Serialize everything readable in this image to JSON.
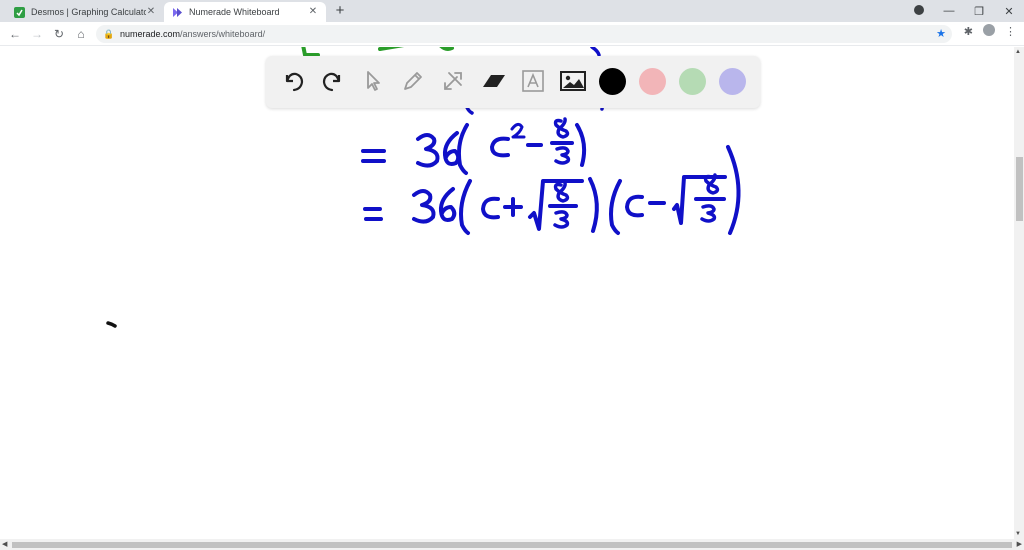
{
  "tabs": [
    {
      "title": "Desmos | Graphing Calculator",
      "icon": "desmos-icon",
      "active": false
    },
    {
      "title": "Numerade Whiteboard",
      "icon": "numerade-icon",
      "active": true
    }
  ],
  "address_bar": {
    "host": "numerade.com",
    "path": "/answers/whiteboard/"
  },
  "palette": {
    "tools": [
      "undo-icon",
      "redo-icon",
      "select-pointer-icon",
      "pen-icon",
      "tools-icon",
      "eraser-icon",
      "text-icon",
      "image-icon"
    ],
    "colors": [
      "#000000",
      "#f2b5b8",
      "#b5dbb4",
      "#b9b6ec"
    ],
    "selected_color": "#000000"
  },
  "handwriting": {
    "ink_color": "#1010c8",
    "green_ink_color": "#2a9d2a",
    "line1": "= 36 ( c² − 8/3 )",
    "line2": "= 36 ( c + √(8/3) ) ( c − √(8/3) )"
  }
}
